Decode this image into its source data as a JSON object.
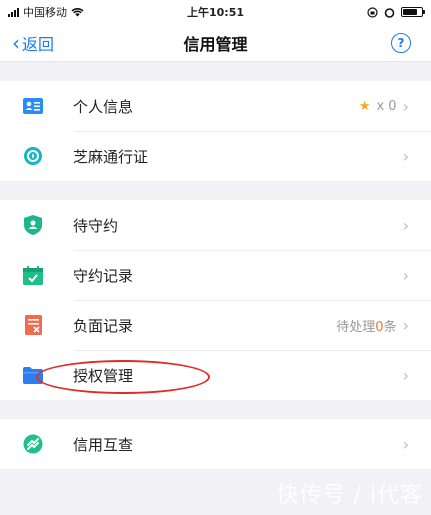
{
  "statusbar": {
    "carrier": "中国移动",
    "time": "上午10:51"
  },
  "nav": {
    "back_label": "返回",
    "title": "信用管理",
    "help_glyph": "?"
  },
  "sections": [
    {
      "rows": [
        {
          "label": "个人信息",
          "icon": "id-card-icon",
          "right_text": "x 0",
          "has_star": true
        },
        {
          "label": "芝麻通行证",
          "icon": "sesame-pass-icon"
        }
      ]
    },
    {
      "rows": [
        {
          "label": "待守约",
          "icon": "shield-person-icon"
        },
        {
          "label": "守约记录",
          "icon": "calendar-check-icon"
        },
        {
          "label": "负面记录",
          "icon": "negative-doc-icon",
          "right_prefix": "待处理",
          "right_count": "0",
          "right_suffix": "条"
        },
        {
          "label": "授权管理",
          "icon": "folder-icon"
        }
      ]
    },
    {
      "rows": [
        {
          "label": "信用互查",
          "icon": "mutual-check-icon"
        }
      ]
    }
  ],
  "watermark": "快传号 / i代客",
  "colors": {
    "accent": "#1a7cf7",
    "star": "#f5a623",
    "orange": "#f07a2a",
    "highlight_oval": "#e02b2b"
  }
}
